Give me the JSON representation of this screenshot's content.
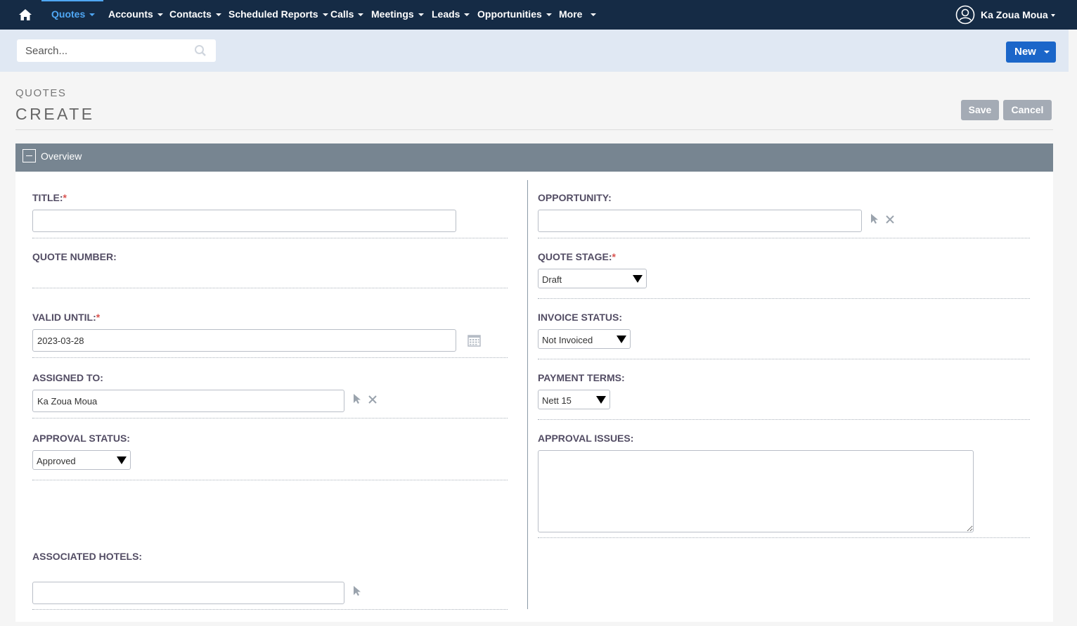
{
  "nav": {
    "items": [
      {
        "label": "Quotes"
      },
      {
        "label": "Accounts"
      },
      {
        "label": "Contacts"
      },
      {
        "label": "Scheduled Reports"
      },
      {
        "label": "Calls"
      },
      {
        "label": "Meetings"
      },
      {
        "label": "Leads"
      },
      {
        "label": "Opportunities"
      },
      {
        "label": "More"
      }
    ],
    "user_name": "Ka Zoua Moua"
  },
  "search": {
    "placeholder": "Search..."
  },
  "actions": {
    "new_label": "New",
    "save_label": "Save",
    "cancel_label": "Cancel"
  },
  "header": {
    "module": "QUOTES",
    "title": "CREATE"
  },
  "panel": {
    "title": "Overview"
  },
  "fields": {
    "title": {
      "label": "TITLE:",
      "required_mark": "*",
      "value": ""
    },
    "quote_number": {
      "label": "QUOTE NUMBER:"
    },
    "valid_until": {
      "label": "VALID UNTIL:",
      "required_mark": "*",
      "value": "2023-03-28"
    },
    "assigned_to": {
      "label": "ASSIGNED TO:",
      "value": "Ka Zoua Moua"
    },
    "approval_status": {
      "label": "APPROVAL STATUS:",
      "value": "Approved"
    },
    "associated_hotels": {
      "label": "ASSOCIATED HOTELS:",
      "value": ""
    },
    "opportunity": {
      "label": "OPPORTUNITY:",
      "value": ""
    },
    "quote_stage": {
      "label": "QUOTE STAGE:",
      "required_mark": "*",
      "value": "Draft"
    },
    "invoice_status": {
      "label": "INVOICE STATUS:",
      "value": "Not Invoiced"
    },
    "payment_terms": {
      "label": "PAYMENT TERMS:",
      "value": "Nett 15"
    },
    "approval_issues": {
      "label": "APPROVAL ISSUES:",
      "value": ""
    }
  },
  "colors": {
    "navbar": "#152b45",
    "active": "#4fa7f4",
    "primary_button": "#1b66c9",
    "panel_header": "#778591",
    "required": "#d9534f"
  }
}
